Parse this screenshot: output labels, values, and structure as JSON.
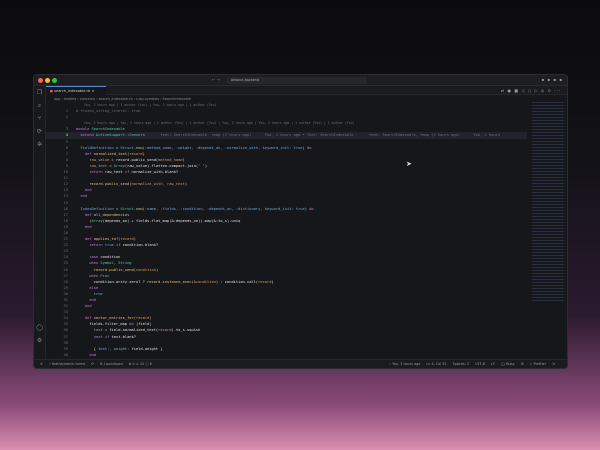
{
  "window": {
    "search": "aiwave-backend",
    "nav": "← →",
    "title_right": "▪ ▪ ▪ ▪"
  },
  "tab": {
    "label": "search_indexable.rb",
    "close": "×"
  },
  "editor_tools": "⇄ ● ■ ◁ ○ ▷ ◎ ⊖ ···",
  "breadcrumb": "app › models › concerns › search_indexable.rb › ruby-symbols › SearchIndexable",
  "activity": [
    "❐",
    "⌕",
    "⑂",
    "⟳",
    "✲",
    "◯",
    "⚙"
  ],
  "code_lines": [
    {
      "blame": "You, 2 hours ago | 1 author (You) | You, 2 hours ago | 1 author (You)"
    },
    {
      "n": "1",
      "seg": [
        [
          "g",
          "# frozen_string_literal: true"
        ]
      ]
    },
    {
      "n": "2",
      "seg": []
    },
    {
      "blame": "You, 2 hours ago | You, 2 hours ago | 1 author (You) | 1 author (You) | You, 2 hours ago | You, 2 hours ago | 1 author (You) | 1 author (You)"
    },
    {
      "n": "3",
      "seg": [
        [
          "k",
          "module "
        ],
        [
          "c",
          "SearchIndexable"
        ]
      ]
    },
    {
      "n": "4",
      "cur": true,
      "seg": [
        [
          "k",
          "  extend "
        ],
        [
          "c",
          "ActiveSupport::Concern"
        ],
        [
          "g",
          "       feat: SearchIndexable, rmap (2 hours ago)      You, 2 hours ago • feat: SearchIndexable       feat: SearchIndexable, rmap (2 hours ago)      You, 2 hours"
        ]
      ]
    },
    {
      "n": "5",
      "seg": []
    },
    {
      "n": "6",
      "seg": [
        [
          "s",
          "  FieldDefinition "
        ],
        [
          "o",
          "= "
        ],
        [
          "c",
          "Struct"
        ],
        [
          "o",
          "."
        ],
        [
          "y",
          "new"
        ],
        [
          "p",
          "("
        ],
        [
          "s",
          ":method_name, :weight, :depends_on, :normalize_with, keyword_init: true"
        ],
        [
          "p",
          ")"
        ],
        [
          "k",
          " do"
        ]
      ]
    },
    {
      "n": "7",
      "seg": [
        [
          "k",
          "    def "
        ],
        [
          "y",
          "normalized_text"
        ],
        [
          "p",
          "("
        ],
        [
          "f",
          "record"
        ],
        [
          "p",
          ")"
        ]
      ]
    },
    {
      "n": "8",
      "seg": [
        [
          "f",
          "      raw_value "
        ],
        [
          "o",
          "= record.public_send("
        ],
        [
          "f",
          "method_name"
        ],
        [
          "o",
          ")"
        ]
      ]
    },
    {
      "n": "9",
      "seg": [
        [
          "f",
          "      raw_text "
        ],
        [
          "o",
          "= "
        ],
        [
          "c",
          "Array"
        ],
        [
          "o",
          "(raw_value).flatten.compact.join("
        ],
        [
          "p",
          "' '"
        ],
        [
          "o",
          ")"
        ]
      ]
    },
    {
      "n": "10",
      "seg": [
        [
          "k",
          "      return "
        ],
        [
          "o",
          "raw_text "
        ],
        [
          "k",
          "if "
        ],
        [
          "o",
          "normalize_with.blank?"
        ]
      ]
    },
    {
      "n": "11",
      "seg": []
    },
    {
      "n": "12",
      "seg": [
        [
          "y",
          "      record.public_send"
        ],
        [
          "p",
          "("
        ],
        [
          "f",
          "normalize_with, raw_text"
        ],
        [
          "p",
          ")"
        ]
      ]
    },
    {
      "n": "13",
      "seg": [
        [
          "k",
          "    end"
        ]
      ]
    },
    {
      "n": "14",
      "seg": [
        [
          "k",
          "  end"
        ]
      ]
    },
    {
      "n": "15",
      "seg": []
    },
    {
      "n": "16",
      "seg": [
        [
          "s",
          "  IndexDefinition "
        ],
        [
          "o",
          "= "
        ],
        [
          "c",
          "Struct"
        ],
        [
          "o",
          "."
        ],
        [
          "y",
          "new"
        ],
        [
          "p",
          "("
        ],
        [
          "s",
          ":name, :fields, :condition, :depends_on, :dictionary, keyword_init: true"
        ],
        [
          "p",
          ")"
        ],
        [
          "k",
          " do"
        ]
      ]
    },
    {
      "n": "17",
      "seg": [
        [
          "k",
          "    def "
        ],
        [
          "y",
          "all_dependencies"
        ]
      ]
    },
    {
      "n": "18",
      "seg": [
        [
          "p",
          "      ("
        ],
        [
          "c",
          "Array"
        ],
        [
          "o",
          "(depends_on) + fields.flat_map(&:depends_on)).map(&:to_s).uniq"
        ]
      ]
    },
    {
      "n": "19",
      "seg": [
        [
          "k",
          "    end"
        ]
      ]
    },
    {
      "n": "20",
      "seg": []
    },
    {
      "n": "21",
      "seg": [
        [
          "k",
          "    def "
        ],
        [
          "y",
          "applies_to?"
        ],
        [
          "p",
          "("
        ],
        [
          "f",
          "record"
        ],
        [
          "p",
          ")"
        ]
      ]
    },
    {
      "n": "22",
      "seg": [
        [
          "k",
          "      return "
        ],
        [
          "s",
          "true "
        ],
        [
          "k",
          "if "
        ],
        [
          "o",
          "condition.blank?"
        ]
      ]
    },
    {
      "n": "23",
      "seg": []
    },
    {
      "n": "24",
      "seg": [
        [
          "k",
          "      case "
        ],
        [
          "o",
          "condition"
        ]
      ]
    },
    {
      "n": "25",
      "seg": [
        [
          "k",
          "      when "
        ],
        [
          "c",
          "Symbol"
        ],
        [
          "o",
          ", "
        ],
        [
          "c",
          "String"
        ]
      ]
    },
    {
      "n": "26",
      "seg": [
        [
          "y",
          "        record.public_send"
        ],
        [
          "p",
          "("
        ],
        [
          "f",
          "condition"
        ],
        [
          "p",
          ")"
        ]
      ]
    },
    {
      "n": "27",
      "seg": [
        [
          "k",
          "      when "
        ],
        [
          "c",
          "Proc"
        ]
      ]
    },
    {
      "n": "28",
      "seg": [
        [
          "o",
          "        condition.arity.zero? ? "
        ],
        [
          "y",
          "record.instance_exec"
        ],
        [
          "p",
          "("
        ],
        [
          "f",
          "&condition"
        ],
        [
          "p",
          ")"
        ],
        [
          "o",
          " : condition.call("
        ],
        [
          "f",
          "record"
        ],
        [
          "o",
          ")"
        ]
      ]
    },
    {
      "n": "29",
      "seg": [
        [
          "k",
          "      else"
        ]
      ]
    },
    {
      "n": "30",
      "seg": [
        [
          "s",
          "        true"
        ]
      ]
    },
    {
      "n": "31",
      "seg": [
        [
          "k",
          "      end"
        ]
      ]
    },
    {
      "n": "32",
      "seg": [
        [
          "k",
          "    end"
        ]
      ]
    },
    {
      "n": "33",
      "seg": []
    },
    {
      "n": "34",
      "seg": [
        [
          "k",
          "    def "
        ],
        [
          "y",
          "vector_entries_for"
        ],
        [
          "p",
          "("
        ],
        [
          "f",
          "record"
        ],
        [
          "p",
          ")"
        ]
      ]
    },
    {
      "n": "35",
      "seg": [
        [
          "o",
          "      fields.filter_map "
        ],
        [
          "k",
          "do "
        ],
        [
          "o",
          "|field|"
        ]
      ]
    },
    {
      "n": "36",
      "seg": [
        [
          "f",
          "        text "
        ],
        [
          "o",
          "= field.normalized_text("
        ],
        [
          "f",
          "record"
        ],
        [
          "o",
          ").to_s.squish"
        ]
      ]
    },
    {
      "n": "37",
      "seg": [
        [
          "k",
          "        next if "
        ],
        [
          "o",
          "text.blank?"
        ]
      ]
    },
    {
      "n": "38",
      "seg": []
    },
    {
      "n": "39",
      "seg": [
        [
          "p",
          "        { "
        ],
        [
          "s",
          "text:, weight: "
        ],
        [
          "o",
          "field.weight "
        ],
        [
          "p",
          "}"
        ]
      ]
    },
    {
      "n": "40",
      "seg": [
        [
          "k",
          "      end"
        ]
      ]
    },
    {
      "n": "41",
      "seg": [
        [
          "k",
          "    end"
        ]
      ]
    }
  ],
  "status": {
    "left": [
      "✕",
      "⑂ feat/dynamic-forms",
      "⟳",
      "⇅ Launchpad",
      "⊗ 0 ⚠ 10 ⓘ 6"
    ],
    "right": [
      "◦ You, 2 hours ago",
      "Ln 4, Col 32",
      "Spaces: 2",
      "UTF-8",
      "LF",
      "{} Ruby",
      "⚙",
      "✓ Prettier",
      "⇲"
    ]
  }
}
